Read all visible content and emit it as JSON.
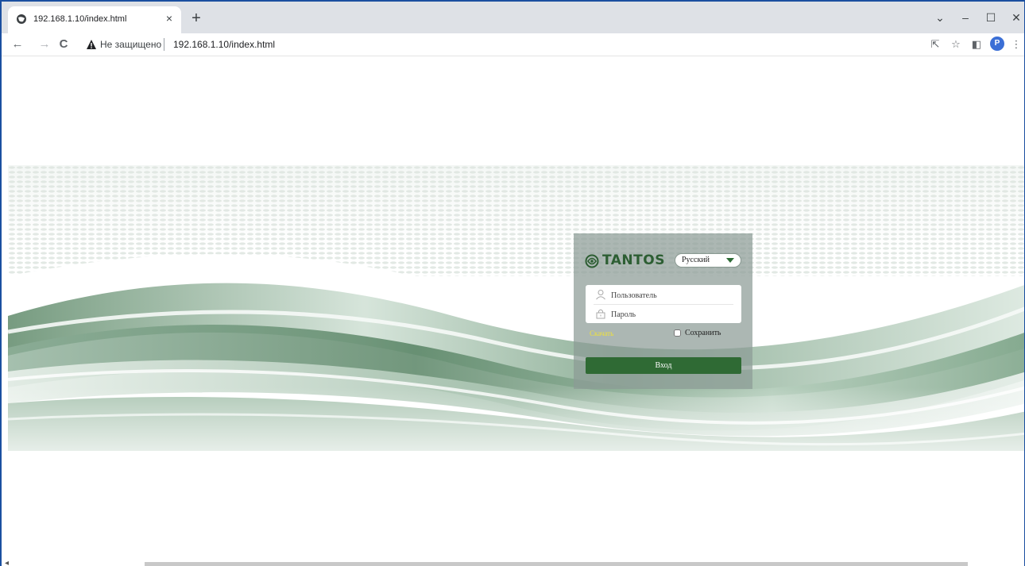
{
  "browser": {
    "tab": {
      "title": "192.168.1.10/index.html",
      "close_label": "×",
      "favicon": "globe-icon"
    },
    "new_tab_label": "+",
    "window_controls": {
      "dropdown": "⌄",
      "minimize": "–",
      "maximize": "☐",
      "close": "✕"
    },
    "nav": {
      "back": "←",
      "forward": "→",
      "reload": "C"
    },
    "omnibox": {
      "security_label": "Не защищено",
      "url": "192.168.1.10/index.html"
    },
    "toolbar_icons": {
      "share": "⇱",
      "bookmark": "☆",
      "sidepanel": "◧",
      "menu": "⋮"
    },
    "profile_initial": "P"
  },
  "login": {
    "logo_text": "TANTOS",
    "language": {
      "selected": "Русский"
    },
    "username": {
      "placeholder": "Пользователь",
      "value": ""
    },
    "password": {
      "placeholder": "Пароль",
      "value": ""
    },
    "download_label": "Скачать",
    "remember_label": "Сохранить",
    "remember_checked": false,
    "submit_label": "Вход"
  },
  "colors": {
    "brand_green": "#2f6a34",
    "logo_green": "#2d5e33",
    "download_yellow": "#f0e23a",
    "window_border": "#1a4fa0"
  }
}
